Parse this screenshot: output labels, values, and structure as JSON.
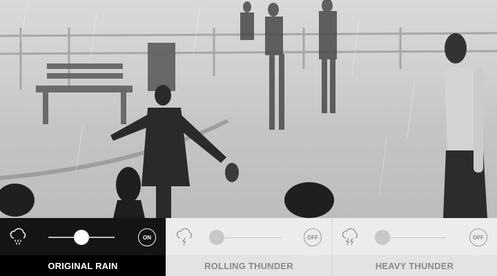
{
  "tracks": [
    {
      "label": "ORIGINAL RAIN",
      "icon": "rain-cloud-icon",
      "toggle": "ON",
      "volume": 0.5,
      "active": true
    },
    {
      "label": "ROLLING THUNDER",
      "icon": "thunder-cloud-icon",
      "toggle": "OFF",
      "volume": 0.0,
      "active": false
    },
    {
      "label": "HEAVY THUNDER",
      "icon": "heavy-thunder-cloud-icon",
      "toggle": "OFF",
      "volume": 0.0,
      "active": false
    }
  ],
  "colors": {
    "active_bg": "#141414",
    "inactive_bg": "#ececec",
    "active_text": "#ffffff",
    "inactive_text": "#8a8a8a"
  }
}
